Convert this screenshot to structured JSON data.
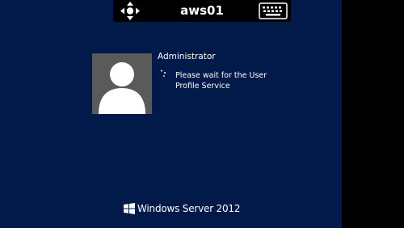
{
  "toolbar": {
    "host_name": "aws01",
    "icons": {
      "move": "move-arrows-icon",
      "keyboard": "keyboard-icon"
    }
  },
  "login": {
    "user_name": "Administrator",
    "status_message": "Please wait for the User Profile Service",
    "avatar_icon": "user-silhouette-icon",
    "spinner_icon": "loading-spinner-icon"
  },
  "branding": {
    "product": "Windows Server 2012",
    "logo_icon": "windows-logo-icon"
  },
  "colors": {
    "background": "#011a4a",
    "avatar_tile": "#5a5a5a",
    "toolbar": "#000000",
    "text": "#ffffff"
  }
}
